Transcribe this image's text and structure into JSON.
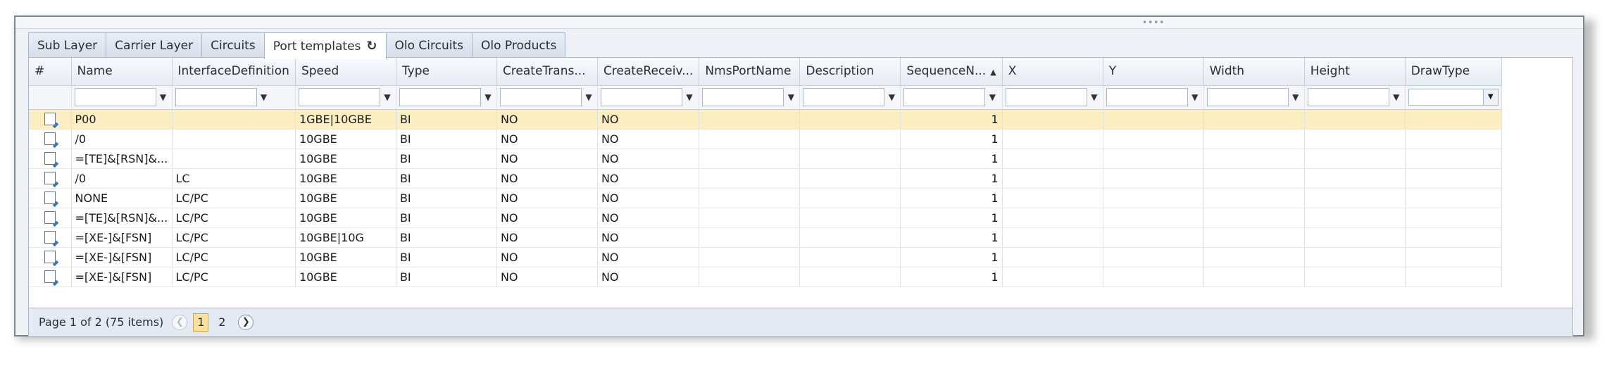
{
  "tabs": [
    {
      "label": "Sub Layer"
    },
    {
      "label": "Carrier Layer"
    },
    {
      "label": "Circuits"
    },
    {
      "label": "Port templates",
      "active": true
    },
    {
      "label": "Olo Circuits"
    },
    {
      "label": "Olo Products"
    }
  ],
  "refresh_icon": "↻",
  "grid": {
    "columns": [
      "#",
      "Name",
      "InterfaceDefinition",
      "Speed",
      "Type",
      "CreateTrans...",
      "CreateReceiv...",
      "NmsPortName",
      "Description",
      "SequenceN...",
      "X",
      "Y",
      "Width",
      "Height",
      "DrawType"
    ],
    "sorted_column": "SequenceN...",
    "sort_direction": "ascending",
    "rows": [
      {
        "name": "P00",
        "interface": "",
        "speed": "1GBE|10GBE",
        "type": "BI",
        "create_trans": "NO",
        "create_receiv": "NO",
        "nms": "",
        "description": "",
        "sequence": "1",
        "x": "",
        "y": "",
        "width": "",
        "height": "",
        "draw_type": "",
        "selected": true
      },
      {
        "name": "/0",
        "interface": "",
        "speed": "10GBE",
        "type": "BI",
        "create_trans": "NO",
        "create_receiv": "NO",
        "nms": "",
        "description": "",
        "sequence": "1",
        "x": "",
        "y": "",
        "width": "",
        "height": "",
        "draw_type": ""
      },
      {
        "name": "=[TE]&[RSN]&...",
        "interface": "",
        "speed": "10GBE",
        "type": "BI",
        "create_trans": "NO",
        "create_receiv": "NO",
        "nms": "",
        "description": "",
        "sequence": "1",
        "x": "",
        "y": "",
        "width": "",
        "height": "",
        "draw_type": ""
      },
      {
        "name": "/0",
        "interface": "LC",
        "speed": "10GBE",
        "type": "BI",
        "create_trans": "NO",
        "create_receiv": "NO",
        "nms": "",
        "description": "",
        "sequence": "1",
        "x": "",
        "y": "",
        "width": "",
        "height": "",
        "draw_type": ""
      },
      {
        "name": "NONE",
        "interface": "LC/PC",
        "speed": "10GBE",
        "type": "BI",
        "create_trans": "NO",
        "create_receiv": "NO",
        "nms": "",
        "description": "",
        "sequence": "1",
        "x": "",
        "y": "",
        "width": "",
        "height": "",
        "draw_type": ""
      },
      {
        "name": "=[TE]&[RSN]&...",
        "interface": "LC/PC",
        "speed": "10GBE",
        "type": "BI",
        "create_trans": "NO",
        "create_receiv": "NO",
        "nms": "",
        "description": "",
        "sequence": "1",
        "x": "",
        "y": "",
        "width": "",
        "height": "",
        "draw_type": ""
      },
      {
        "name": "=[XE-]&[FSN]",
        "interface": "LC/PC",
        "speed": "10GBE|10G",
        "type": "BI",
        "create_trans": "NO",
        "create_receiv": "NO",
        "nms": "",
        "description": "",
        "sequence": "1",
        "x": "",
        "y": "",
        "width": "",
        "height": "",
        "draw_type": ""
      },
      {
        "name": "=[XE-]&[FSN]",
        "interface": "LC/PC",
        "speed": "10GBE",
        "type": "BI",
        "create_trans": "NO",
        "create_receiv": "NO",
        "nms": "",
        "description": "",
        "sequence": "1",
        "x": "",
        "y": "",
        "width": "",
        "height": "",
        "draw_type": ""
      },
      {
        "name": "=[XE-]&[FSN]",
        "interface": "LC/PC",
        "speed": "10GBE",
        "type": "BI",
        "create_trans": "NO",
        "create_receiv": "NO",
        "nms": "",
        "description": "",
        "sequence": "1",
        "x": "",
        "y": "",
        "width": "",
        "height": "",
        "draw_type": ""
      }
    ]
  },
  "pager": {
    "info": "Page 1 of 2 (75 items)",
    "pages": [
      "1",
      "2"
    ],
    "current_page": "1",
    "prev_icon": "❮",
    "next_icon": "❯"
  },
  "colors": {
    "selected_row": "#fbeec0",
    "current_page": "#fbe29a",
    "edit_accent": "#3a78c2"
  }
}
